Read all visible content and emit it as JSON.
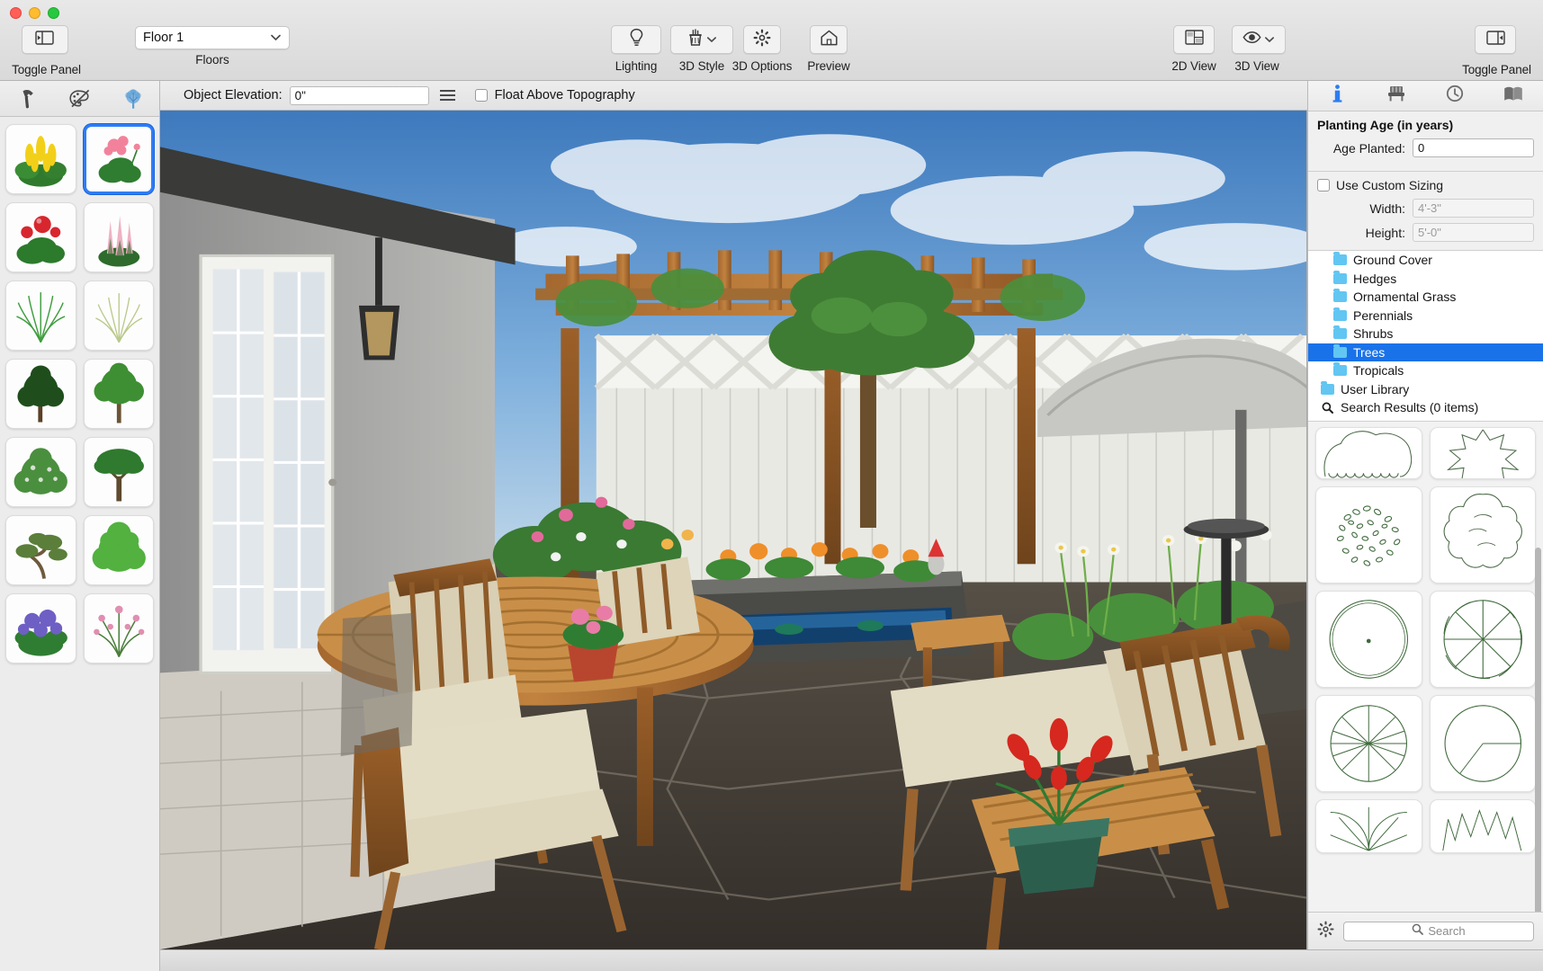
{
  "window": {
    "traffic_lights": [
      "close",
      "minimize",
      "zoom"
    ]
  },
  "toolbar": {
    "toggle_panel_left_label": "Toggle Panel",
    "toggle_panel_left_icon": "panel-left-icon",
    "floors_value": "Floor 1",
    "floors_caption": "Floors",
    "lighting_label": "Lighting",
    "lighting_icon": "lightbulb-icon",
    "style_label": "3D Style",
    "style_icon": "paintbrush-cup-icon",
    "options_label": "3D Options",
    "options_icon": "gear-icon",
    "preview_label": "Preview",
    "preview_icon": "house-icon",
    "view2d_label": "2D View",
    "view2d_icon": "floorplan-grid-icon",
    "view3d_label": "3D View",
    "view3d_icon": "eye-icon",
    "toggle_panel_right_label": "Toggle Panel",
    "toggle_panel_right_icon": "panel-right-icon"
  },
  "left_sidebar": {
    "tools": [
      {
        "name": "hammer-icon",
        "label": "Build"
      },
      {
        "name": "palette-brush-icon",
        "label": "Design"
      },
      {
        "name": "tree-plant-icon",
        "label": "Plants"
      }
    ],
    "plants": [
      {
        "label": "Yellow Shrimp Plant",
        "selected": false
      },
      {
        "label": "Pink Geranium",
        "selected": true
      },
      {
        "label": "Red Geranium",
        "selected": false
      },
      {
        "label": "Pink Astilbe",
        "selected": false
      },
      {
        "label": "Green Ornamental Grass",
        "selected": false
      },
      {
        "label": "Pale Ornamental Grass",
        "selected": false
      },
      {
        "label": "Dark Evergreen Tree",
        "selected": false
      },
      {
        "label": "Broadleaf Tree",
        "selected": false
      },
      {
        "label": "Flowering Shrub",
        "selected": false
      },
      {
        "label": "Shade Tree",
        "selected": false
      },
      {
        "label": "Bonsai Pine",
        "selected": false
      },
      {
        "label": "Green Bush",
        "selected": false
      },
      {
        "label": "Hydrangea",
        "selected": false
      },
      {
        "label": "Flowering Bush",
        "selected": false
      }
    ]
  },
  "elevation_bar": {
    "label": "Object Elevation:",
    "value": "0\"",
    "menu_icon": "list-menu-icon",
    "float_checkbox_checked": false,
    "float_label": "Float Above Topography"
  },
  "right_panel": {
    "tabs": [
      {
        "name": "info-icon",
        "label": "Info",
        "active": true
      },
      {
        "name": "furniture-chair-icon",
        "label": "Furniture",
        "active": false
      },
      {
        "name": "clock-history-icon",
        "label": "History",
        "active": false
      },
      {
        "name": "book-library-icon",
        "label": "Library",
        "active": false
      }
    ],
    "planting": {
      "section_title": "Planting Age (in years)",
      "age_label": "Age Planted:",
      "age_value": "0"
    },
    "sizing": {
      "custom_label": "Use Custom Sizing",
      "custom_checked": false,
      "width_label": "Width:",
      "width_value": "4'-3\"",
      "height_label": "Height:",
      "height_value": "5'-0\""
    },
    "library_tree": [
      {
        "label": "Ground Cover",
        "icon": "folder-icon",
        "level": 2,
        "selected": false
      },
      {
        "label": "Hedges",
        "icon": "folder-icon",
        "level": 2,
        "selected": false
      },
      {
        "label": "Ornamental Grass",
        "icon": "folder-icon",
        "level": 2,
        "selected": false
      },
      {
        "label": "Perennials",
        "icon": "folder-icon",
        "level": 2,
        "selected": false
      },
      {
        "label": "Shrubs",
        "icon": "folder-icon",
        "level": 2,
        "selected": false
      },
      {
        "label": "Trees",
        "icon": "folder-icon",
        "level": 2,
        "selected": true
      },
      {
        "label": "Tropicals",
        "icon": "folder-icon",
        "level": 2,
        "selected": false
      },
      {
        "label": "User Library",
        "icon": "folder-icon",
        "level": 1,
        "selected": false
      },
      {
        "label": "Search Results (0 items)",
        "icon": "search-icon",
        "level": 1,
        "selected": false
      }
    ],
    "symbols": [
      {
        "label": "cloud-outline-canopy-symbol"
      },
      {
        "label": "spiky-star-canopy-symbol"
      },
      {
        "label": "speckled-leaf-canopy-symbol"
      },
      {
        "label": "lobed-canopy-symbol"
      },
      {
        "label": "plain-circle-symbol"
      },
      {
        "label": "segmented-flower-symbol"
      },
      {
        "label": "spoked-wheel-symbol"
      },
      {
        "label": "quarter-arc-circle-symbol"
      },
      {
        "label": "radial-lines-symbol"
      },
      {
        "label": "zigzag-fan-symbol"
      }
    ],
    "search_placeholder": "Search",
    "settings_icon": "gear-icon",
    "search_icon": "search-icon"
  },
  "viewport": {
    "scene_description": "3D rendered backyard patio with pergola, stone paving, wooden table and chairs, white vinyl fence, umbrella and planters"
  },
  "colors": {
    "accent_blue": "#1a72e8",
    "selection_blue": "#2d7dfa",
    "folder_blue": "#62c6f2",
    "info_blue": "#2c7df0",
    "toolbar_bg": "#e4e4e4",
    "panel_bg": "#f0f0f0"
  }
}
